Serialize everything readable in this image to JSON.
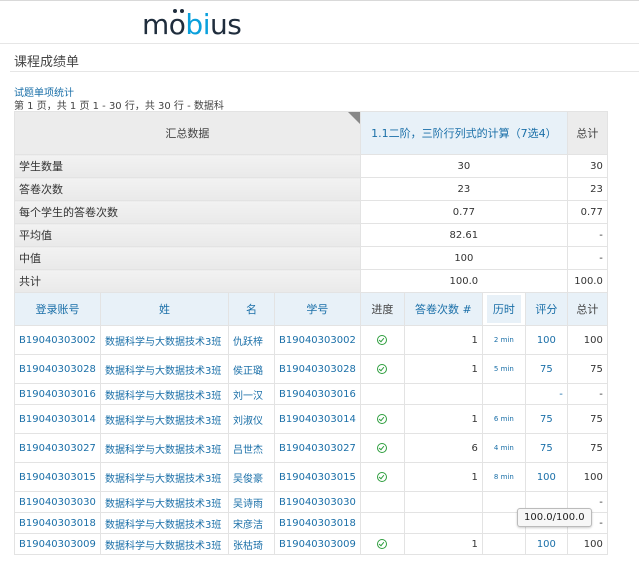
{
  "brand": {
    "logo_text_a": "m",
    "logo_text_o": "o",
    "logo_text_bi": "bi",
    "logo_text_us": "us"
  },
  "page": {
    "title": "课程成绩单",
    "sub_link": "试题单项统计",
    "pager": "第 1 页，共 1 页 1 - 30 行，共 30 行  -  数据科"
  },
  "summary": {
    "header_label": "汇总数据",
    "assignment_label": "1.1二阶，三阶行列式的计算（7选4）",
    "total_label": "总计",
    "rows": [
      {
        "label": "学生数量",
        "value": "30",
        "total": "30"
      },
      {
        "label": "答卷次数",
        "value": "23",
        "total": "23"
      },
      {
        "label": "每个学生的答卷次数",
        "value": "0.77",
        "total": "0.77"
      },
      {
        "label": "平均值",
        "value": "82.61",
        "total": "-"
      },
      {
        "label": "中值",
        "value": "100",
        "total": "-"
      },
      {
        "label": "共计",
        "value": "100.0",
        "total": "100.0"
      }
    ]
  },
  "columns": {
    "login": "登录账号",
    "surname": "姓",
    "given": "名",
    "student_no": "学号",
    "progress": "进度",
    "attempts": "答卷次数 #",
    "time": "历时",
    "score": "评分",
    "total": "总计"
  },
  "students": [
    {
      "login": "B19040303002",
      "class": "数据科学与大数据技术3班",
      "name": "仇跃梓",
      "no": "B19040303002",
      "done": true,
      "attempts": "1",
      "time": "2 min",
      "score": "100",
      "total": "100",
      "short": false
    },
    {
      "login": "B19040303028",
      "class": "数据科学与大数据技术3班",
      "name": "侯正璐",
      "no": "B19040303028",
      "done": true,
      "attempts": "1",
      "time": "5 min",
      "score": "75",
      "total": "75",
      "short": false
    },
    {
      "login": "B19040303016",
      "class": "数据科学与大数据技术3班",
      "name": "刘一汉",
      "no": "B19040303016",
      "done": false,
      "attempts": "",
      "time": "",
      "score": "-",
      "total": "-",
      "short": true
    },
    {
      "login": "B19040303014",
      "class": "数据科学与大数据技术3班",
      "name": "刘淑仪",
      "no": "B19040303014",
      "done": true,
      "attempts": "1",
      "time": "6 min",
      "score": "75",
      "total": "75",
      "short": false
    },
    {
      "login": "B19040303027",
      "class": "数据科学与大数据技术3班",
      "name": "吕世杰",
      "no": "B19040303027",
      "done": true,
      "attempts": "6",
      "time": "4 min",
      "score": "75",
      "total": "75",
      "short": false
    },
    {
      "login": "B19040303015",
      "class": "数据科学与大数据技术3班",
      "name": "吴俊豪",
      "no": "B19040303015",
      "done": true,
      "attempts": "1",
      "time": "8 min",
      "score": "100",
      "total": "100",
      "short": false
    },
    {
      "login": "B19040303030",
      "class": "数据科学与大数据技术3班",
      "name": "吴诗雨",
      "no": "B19040303030",
      "done": false,
      "attempts": "",
      "time": "",
      "score": "",
      "total": "-",
      "short": true
    },
    {
      "login": "B19040303018",
      "class": "数据科学与大数据技术3班",
      "name": "宋彦洁",
      "no": "B19040303018",
      "done": false,
      "attempts": "",
      "time": "",
      "score": "",
      "total": "-",
      "short": true
    },
    {
      "login": "B19040303009",
      "class": "数据科学与大数据技术3班",
      "name": "张枯琦",
      "no": "B19040303009",
      "done": true,
      "attempts": "1",
      "time": "",
      "score": "100",
      "total": "100",
      "short": true
    }
  ],
  "tooltip": "100.0/100.0",
  "colors": {
    "link": "#1a6fa8",
    "header_bg": "#e8f1f8",
    "check": "#2e9e3e",
    "logo_accent": "#0aa0dc"
  }
}
